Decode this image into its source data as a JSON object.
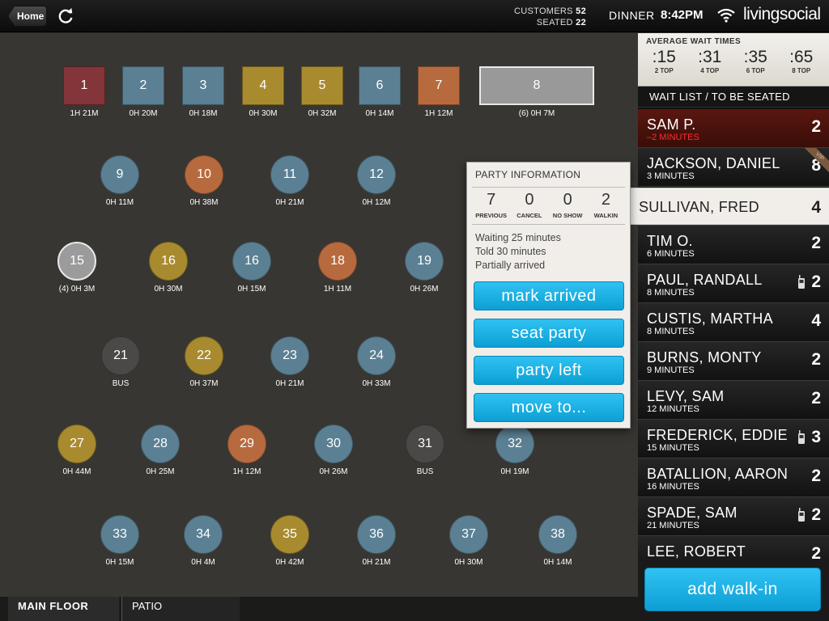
{
  "topbar": {
    "home_label": "Home",
    "customers_label": "CUSTOMERS",
    "customers_count": "52",
    "seated_label": "SEATED",
    "seated_count": "22",
    "meal": "DINNER",
    "time": "8:42PM",
    "brand": "livingsocial"
  },
  "tables": [
    {
      "id": "1",
      "shape": "square",
      "color": "#83353a",
      "label": "1H 21M"
    },
    {
      "id": "2",
      "shape": "square",
      "color": "#5b8093",
      "label": "0H 20M"
    },
    {
      "id": "3",
      "shape": "square",
      "color": "#5b8093",
      "label": "0H 18M"
    },
    {
      "id": "4",
      "shape": "square",
      "color": "#a98b2f",
      "label": "0H 30M"
    },
    {
      "id": "5",
      "shape": "square",
      "color": "#a98b2f",
      "label": "0H 32M"
    },
    {
      "id": "6",
      "shape": "square",
      "color": "#5b8093",
      "label": "0H 14M"
    },
    {
      "id": "7",
      "shape": "square",
      "color": "#b86a3f",
      "label": "1H 12M"
    },
    {
      "id": "8",
      "shape": "wide",
      "color": "#999999",
      "label": "(6) 0H 7M"
    },
    {
      "id": "9",
      "shape": "round",
      "color": "#5b8093",
      "label": "0H 11M"
    },
    {
      "id": "10",
      "shape": "round",
      "color": "#b86a3f",
      "label": "0H 38M"
    },
    {
      "id": "11",
      "shape": "round",
      "color": "#5b8093",
      "label": "0H 21M"
    },
    {
      "id": "12",
      "shape": "round",
      "color": "#5b8093",
      "label": "0H 12M"
    },
    {
      "id": "15",
      "shape": "round",
      "color": "#9b9b9b",
      "label": "(4) 0H 3M"
    },
    {
      "id": "16",
      "shape": "round",
      "color": "#a98b2f",
      "label": "0H 30M"
    },
    {
      "id": "16",
      "shape": "round",
      "color": "#5b8093",
      "label": "0H 15M"
    },
    {
      "id": "18",
      "shape": "round",
      "color": "#b86a3f",
      "label": "1H 11M"
    },
    {
      "id": "19",
      "shape": "round",
      "color": "#5b8093",
      "label": "0H 26M"
    },
    {
      "id": "21",
      "shape": "round",
      "color": "#4a4947",
      "label": "BUS"
    },
    {
      "id": "22",
      "shape": "round",
      "color": "#a98b2f",
      "label": "0H 37M"
    },
    {
      "id": "23",
      "shape": "round",
      "color": "#5b8093",
      "label": "0H 21M"
    },
    {
      "id": "24",
      "shape": "round",
      "color": "#5b8093",
      "label": "0H 33M"
    },
    {
      "id": "27",
      "shape": "round",
      "color": "#a98b2f",
      "label": "0H 44M"
    },
    {
      "id": "28",
      "shape": "round",
      "color": "#5b8093",
      "label": "0H 25M"
    },
    {
      "id": "29",
      "shape": "round",
      "color": "#b86a3f",
      "label": "1H 12M"
    },
    {
      "id": "30",
      "shape": "round",
      "color": "#5b8093",
      "label": "0H 26M"
    },
    {
      "id": "31",
      "shape": "round",
      "color": "#4a4947",
      "label": "BUS"
    },
    {
      "id": "32",
      "shape": "round",
      "color": "#5b8093",
      "label": "0H 19M"
    },
    {
      "id": "33",
      "shape": "round",
      "color": "#5b8093",
      "label": "0H 15M"
    },
    {
      "id": "34",
      "shape": "round",
      "color": "#5b8093",
      "label": "0H 4M"
    },
    {
      "id": "35",
      "shape": "round",
      "color": "#a98b2f",
      "label": "0H 42M"
    },
    {
      "id": "36",
      "shape": "round",
      "color": "#5b8093",
      "label": "0H 21M"
    },
    {
      "id": "37",
      "shape": "round",
      "color": "#5b8093",
      "label": "0H 30M"
    },
    {
      "id": "38",
      "shape": "round",
      "color": "#5b8093",
      "label": "0H 14M"
    }
  ],
  "floor_tabs": [
    "MAIN FLOOR",
    "PATIO"
  ],
  "average_wait": {
    "title": "AVERAGE WAIT TIMES",
    "items": [
      {
        "value": ":15",
        "label": "2 TOP"
      },
      {
        "value": ":31",
        "label": "4 TOP"
      },
      {
        "value": ":35",
        "label": "6 TOP"
      },
      {
        "value": ":65",
        "label": "8 TOP"
      }
    ]
  },
  "waitlist": {
    "title": "WAIT LIST / TO BE SEATED",
    "items": [
      {
        "name": "SAM P.",
        "wait": "–2 MINUTES",
        "size": "2",
        "state": "alert"
      },
      {
        "name": "JACKSON, DANIEL",
        "wait": "3 MINUTES",
        "size": "8",
        "vip": "VIP"
      },
      {
        "name": "SULLIVAN, FRED",
        "wait": "",
        "size": "4",
        "state": "selected"
      },
      {
        "name": "TIM O.",
        "wait": "6 MINUTES",
        "size": "2"
      },
      {
        "name": "PAUL, RANDALL",
        "wait": "8  MINUTES",
        "size": "2",
        "phone": "phone-icon"
      },
      {
        "name": "CUSTIS, MARTHA",
        "wait": "8 MINUTES",
        "size": "4"
      },
      {
        "name": "BURNS, MONTY",
        "wait": "9 MINUTES",
        "size": "2"
      },
      {
        "name": "LEVY, SAM",
        "wait": "12 MINUTES",
        "size": "2"
      },
      {
        "name": "FREDERICK, EDDIE",
        "wait": "15 MINUTES",
        "size": "3",
        "phone": "phone-icon"
      },
      {
        "name": "BATALLION, AARON",
        "wait": "16 MINUTES",
        "size": "2"
      },
      {
        "name": "SPADE, SAM",
        "wait": "21 MINUTES",
        "size": "2",
        "phone": "phone-icon"
      },
      {
        "name": "LEE, ROBERT",
        "wait": "",
        "size": "2"
      }
    ]
  },
  "party_info": {
    "title": "PARTY INFORMATION",
    "stats": [
      {
        "value": "7",
        "label": "PREVIOUS"
      },
      {
        "value": "0",
        "label": "CANCEL"
      },
      {
        "value": "0",
        "label": "NO SHOW"
      },
      {
        "value": "2",
        "label": "WALKIN"
      }
    ],
    "lines": [
      "Waiting 25 minutes",
      "Told 30 minutes",
      "Partially arrived"
    ],
    "buttons": [
      "mark arrived",
      "seat party",
      "party left",
      "move to..."
    ]
  },
  "add_walkin": "add walk-in",
  "colors": {
    "accent_blue": "#1bb1e6",
    "floor_bg": "#383632",
    "table_blue": "#5b8093",
    "table_gold": "#a98b2f",
    "table_orange": "#b86a3f",
    "table_red": "#83353a",
    "alert_red": "#ff2d2d"
  }
}
